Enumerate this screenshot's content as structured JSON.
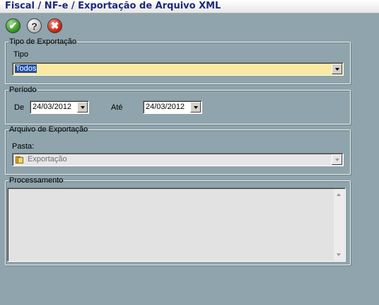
{
  "window": {
    "title": "Fiscal / NF-e / Exportação de Arquivo XML"
  },
  "toolbar": {
    "ok_icon": "✔",
    "help_icon": "?",
    "cancel_icon": "✖"
  },
  "tipo_exportacao": {
    "legend": "Tipo de Exportação",
    "tipo_label": "Tipo",
    "tipo_value": "Todos",
    "field_color": "#fbe9a3"
  },
  "periodo": {
    "legend": "Período",
    "de_label": "De",
    "de_value": "24/03/2012",
    "ate_label": "Até",
    "ate_value": "24/03/2012"
  },
  "arquivo": {
    "legend": "Arquivo de Exportação",
    "pasta_label": "Pasta:",
    "pasta_value": "Exportação"
  },
  "processamento": {
    "legend": "Processamento",
    "log_text": ""
  }
}
